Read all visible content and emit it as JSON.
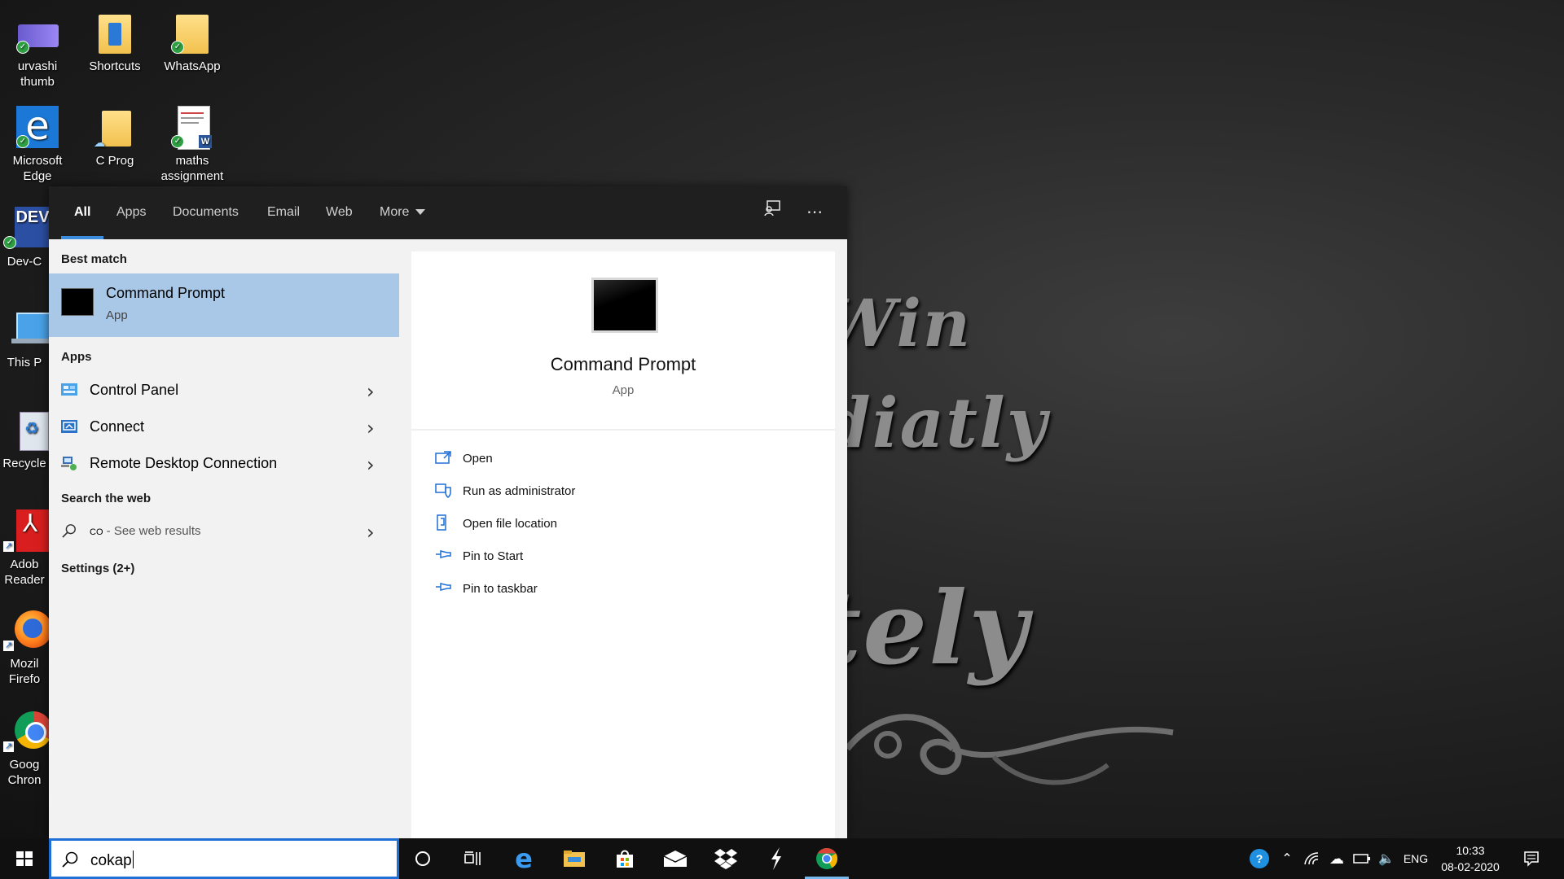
{
  "wallpaper": {
    "line1": "Win",
    "line2": "diatly",
    "line3": "tely"
  },
  "desktop_icons": [
    {
      "label": "urvashi\nthumb",
      "icon": "image-thumbnail-icon"
    },
    {
      "label": "Shortcuts",
      "icon": "folder-icon"
    },
    {
      "label": "WhatsApp",
      "icon": "folder-icon"
    },
    {
      "label": "Microsoft\nEdge",
      "icon": "edge-icon"
    },
    {
      "label": "C Prog",
      "icon": "folder-icon"
    },
    {
      "label": "maths\nassignment",
      "icon": "word-document-icon"
    },
    {
      "label": "Dev-C",
      "icon": "devcpp-icon"
    },
    {
      "label": "This P",
      "icon": "computer-icon"
    },
    {
      "label": "Recycle",
      "icon": "recycle-bin-icon"
    },
    {
      "label": "Adob\nReader",
      "icon": "pdf-icon"
    },
    {
      "label": "Mozil\nFirefo",
      "icon": "firefox-icon"
    },
    {
      "label": "Goog\nChron",
      "icon": "chrome-icon"
    }
  ],
  "search_flyout": {
    "tabs": [
      "All",
      "Apps",
      "Documents",
      "Email",
      "Web",
      "More"
    ],
    "active_tab": "All",
    "best_match": {
      "section": "Best match",
      "title": "Command Prompt",
      "subtitle": "App"
    },
    "apps_section": "Apps",
    "apps": [
      {
        "label": "Control Panel",
        "icon": "control-panel-icon"
      },
      {
        "label": "Connect",
        "icon": "connect-icon"
      },
      {
        "label": "Remote Desktop Connection",
        "icon": "remote-desktop-icon"
      }
    ],
    "web_section": "Search the web",
    "web_query": "co",
    "web_suffix": " - See web results",
    "settings_section": "Settings (2+)",
    "preview": {
      "title": "Command Prompt",
      "subtitle": "App",
      "actions": [
        {
          "label": "Open",
          "icon": "open-icon"
        },
        {
          "label": "Run as administrator",
          "icon": "shield-icon"
        },
        {
          "label": "Open file location",
          "icon": "file-location-icon"
        },
        {
          "label": "Pin to Start",
          "icon": "pin-icon"
        },
        {
          "label": "Pin to taskbar",
          "icon": "pin-icon"
        }
      ]
    }
  },
  "taskbar": {
    "search_value": "cokap",
    "language": "ENG",
    "time": "10:33",
    "date": "08-02-2020"
  },
  "colors": {
    "accent": "#1f6fd6",
    "selection": "#a9c8e8",
    "flyout_header": "#1f1f1f",
    "taskbar": "#101010"
  }
}
